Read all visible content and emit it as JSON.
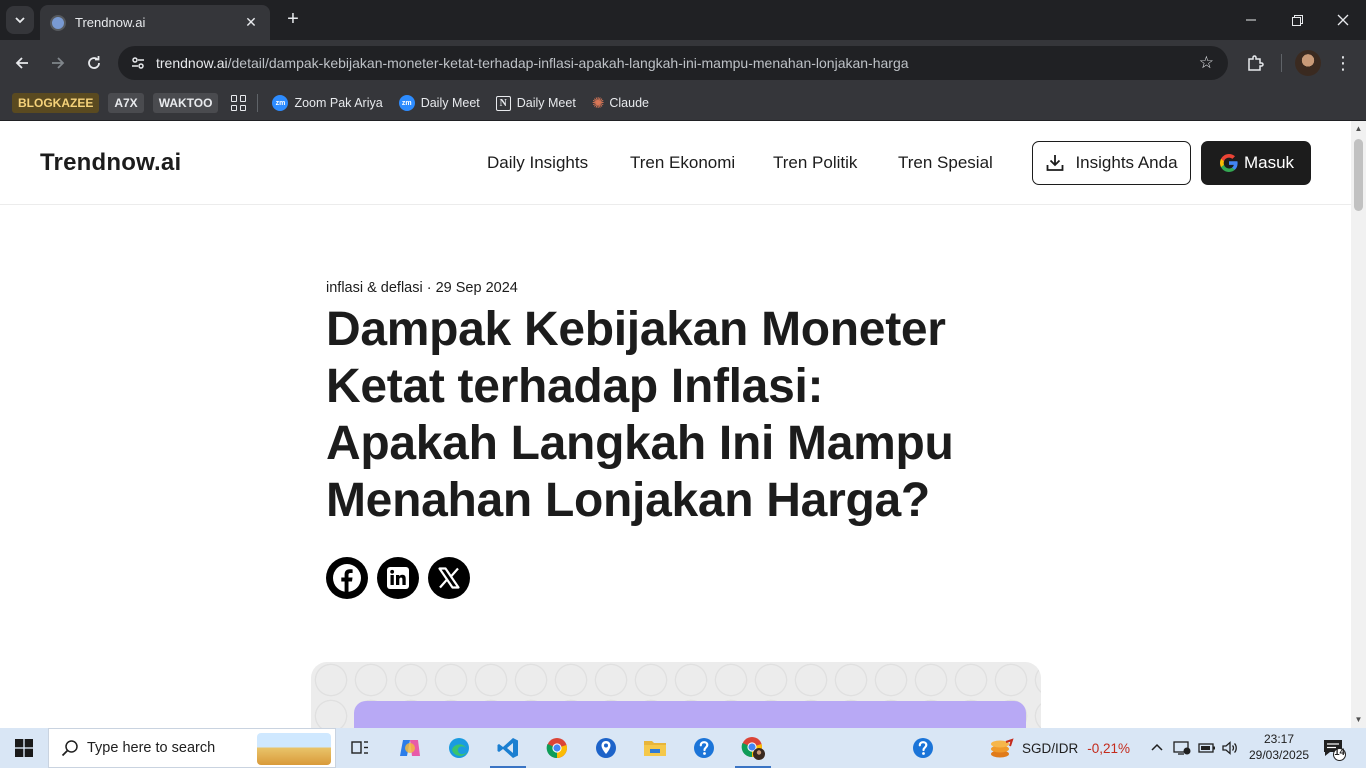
{
  "browser": {
    "tab_title": "Trendnow.ai",
    "url_host": "trendnow.ai",
    "url_path": "/detail/dampak-kebijakan-moneter-ketat-terhadap-inflasi-apakah-langkah-ini-mampu-menahan-lonjakan-harga",
    "bookmarks": {
      "chip1": "BLOGKAZEE",
      "chip2": "A7X",
      "chip3": "WAKTOO",
      "link1": "Zoom Pak Ariya",
      "link2": "Daily Meet",
      "link3": "Daily Meet",
      "link4": "Claude",
      "zoom_badge": "zm",
      "notion_badge": "N"
    }
  },
  "site": {
    "brand": "Trendnow.ai",
    "nav": [
      "Daily Insights",
      "Tren Ekonomi",
      "Tren Politik",
      "Tren Spesial"
    ],
    "insights_button": "Insights Anda",
    "login_button": "Masuk"
  },
  "article": {
    "meta": "inflasi & deflasi · 29 Sep 2024",
    "title": "Dampak Kebijakan Moneter Ketat terhadap Inflasi: Apakah Langkah Ini Mampu Menahan Lonjakan Harga?"
  },
  "taskbar": {
    "search_placeholder": "Type here to search",
    "ticker_label": "SGD/IDR",
    "ticker_value": "-0,21%",
    "time": "23:17",
    "date": "29/03/2025",
    "notification_count": "14"
  },
  "colors": {
    "ticker_negative": "#c42b1c",
    "accent_purple": "#b8a9f5",
    "dark": "#1c1c1c"
  }
}
